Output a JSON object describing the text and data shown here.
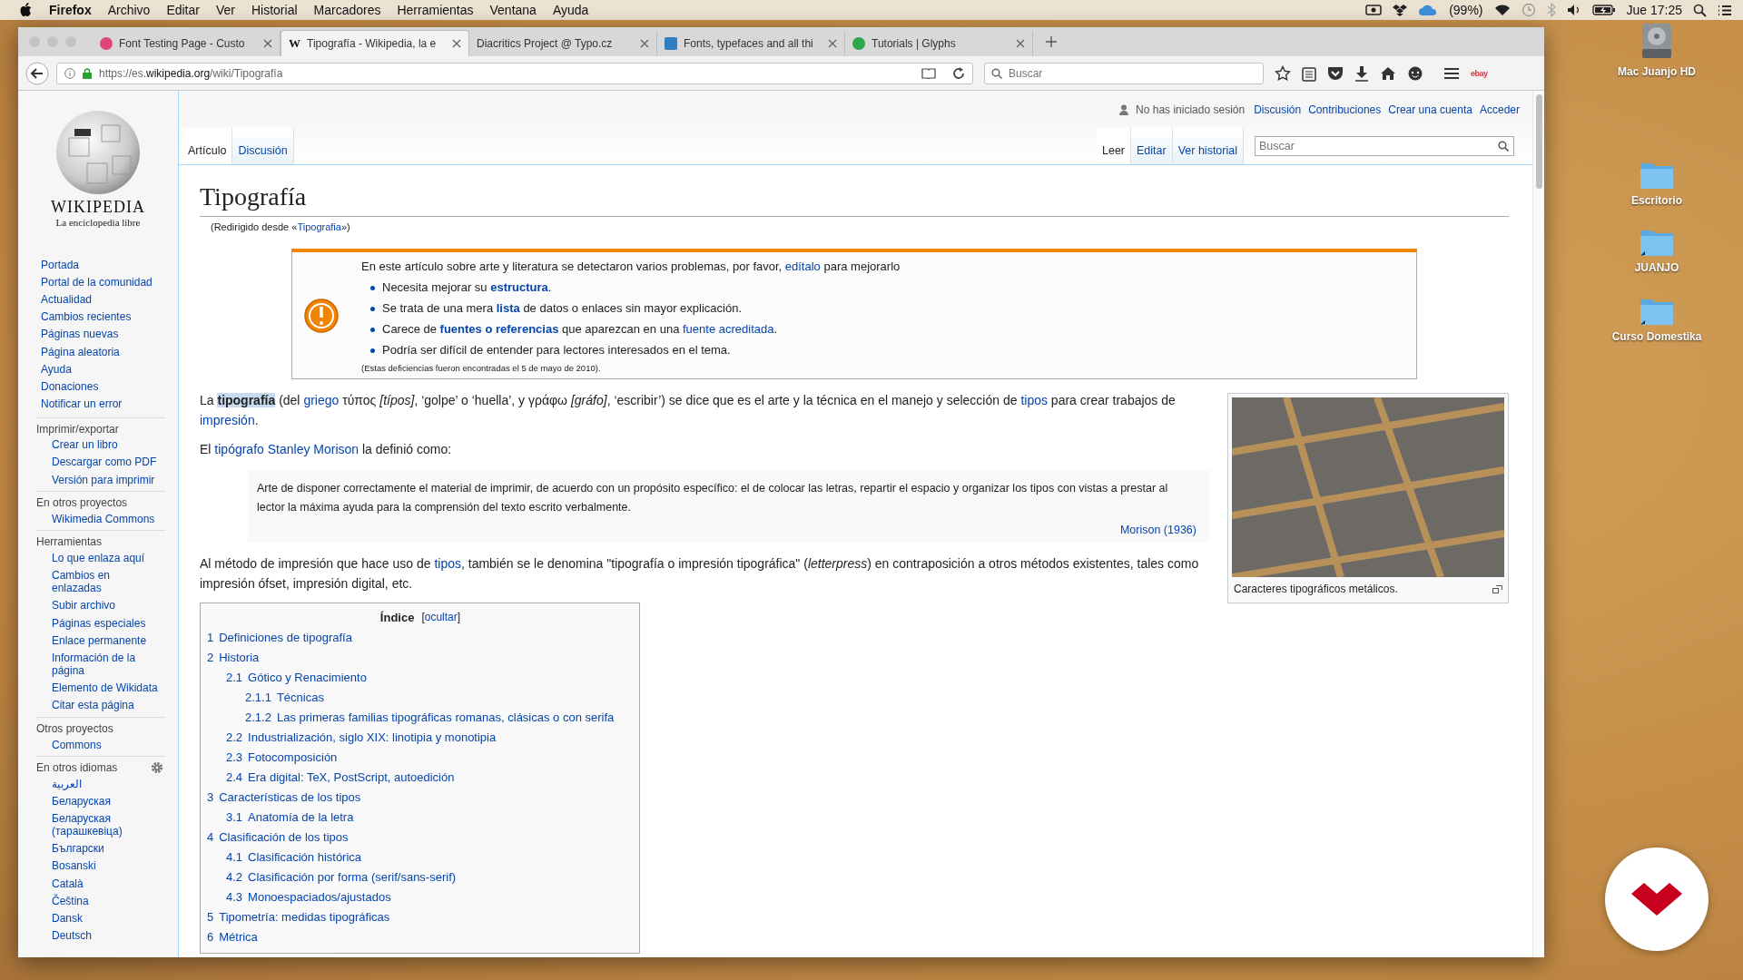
{
  "menubar": {
    "app": "Firefox",
    "menus": [
      "Archivo",
      "Editar",
      "Ver",
      "Historial",
      "Marcadores",
      "Herramientas",
      "Ventana",
      "Ayuda"
    ],
    "battery_status": "(99%)",
    "clock": "Jue 17:25"
  },
  "browser": {
    "tabs": [
      {
        "title": "Font Testing Page - Custo",
        "selected": false,
        "favicon": {
          "kind": "circle",
          "color": "#e0457b"
        }
      },
      {
        "title": "Tipografía - Wikipedia, la e",
        "selected": true,
        "favicon": {
          "kind": "letter",
          "text": "W"
        }
      },
      {
        "title": "Diacritics Project @ Typo.cz",
        "selected": false,
        "favicon": {
          "kind": "none"
        }
      },
      {
        "title": "Fonts, typefaces and all thi",
        "selected": false,
        "favicon": {
          "kind": "square",
          "color": "#2f7fc1"
        }
      },
      {
        "title": "Tutorials | Glyphs",
        "selected": false,
        "favicon": {
          "kind": "circle",
          "color": "#2aa84a"
        }
      }
    ],
    "url": {
      "prefix": "https://es.",
      "host": "wikipedia.org",
      "path": "/wiki/Tipografía"
    },
    "search": {
      "placeholder": "Buscar"
    },
    "extension_label": "ebay"
  },
  "wiki": {
    "logo": {
      "wordmark": "WIKIPEDIA",
      "tagline": "La enciclopedia libre"
    },
    "nav": {
      "main": [
        "Portada",
        "Portal de la comunidad",
        "Actualidad",
        "Cambios recientes",
        "Páginas nuevas",
        "Página aleatoria",
        "Ayuda",
        "Donaciones",
        "Notificar un error"
      ],
      "sections": [
        {
          "heading": "Imprimir/exportar",
          "has_settings": false,
          "items": [
            "Crear un libro",
            "Descargar como PDF",
            "Versión para imprimir"
          ]
        },
        {
          "heading": "En otros proyectos",
          "has_settings": false,
          "items": [
            "Wikimedia Commons"
          ]
        },
        {
          "heading": "Herramientas",
          "has_settings": false,
          "items": [
            "Lo que enlaza aquí",
            "Cambios en enlazadas",
            "Subir archivo",
            "Páginas especiales",
            "Enlace permanente",
            "Información de la página",
            "Elemento de Wikidata",
            "Citar esta página"
          ]
        },
        {
          "heading": "Otros proyectos",
          "has_settings": false,
          "items": [
            "Commons"
          ]
        },
        {
          "heading": "En otros idiomas",
          "has_settings": true,
          "items": [
            "العربية",
            "Беларуская",
            "Беларуская (тарашкевіца)",
            "Български",
            "Bosanski",
            "Català",
            "Čeština",
            "Dansk",
            "Deutsch"
          ]
        }
      ]
    },
    "personal": {
      "status": "No has iniciado sesión",
      "links": [
        "Discusión",
        "Contribuciones",
        "Crear una cuenta",
        "Acceder"
      ]
    },
    "namespace_tabs": [
      {
        "label": "Artículo",
        "selected": true
      },
      {
        "label": "Discusión",
        "selected": false
      }
    ],
    "view_tabs": [
      {
        "label": "Leer",
        "selected": true
      },
      {
        "label": "Editar",
        "selected": false
      },
      {
        "label": "Ver historial",
        "selected": false
      }
    ],
    "search": {
      "placeholder": "Buscar"
    },
    "article": {
      "title": "Tipografía",
      "redirect": [
        {
          "t": "(Redirigido desde «",
          "kind": "text"
        },
        {
          "t": "Tipografia",
          "kind": "link"
        },
        {
          "t": "»)",
          "kind": "text"
        }
      ],
      "notice": {
        "intro": [
          {
            "t": "En este artículo sobre arte y literatura se detectaron varios problemas, por favor, ",
            "kind": "text"
          },
          {
            "t": "edítalo",
            "kind": "link"
          },
          {
            "t": " para mejorarlo",
            "kind": "text"
          }
        ],
        "bullets": [
          [
            {
              "t": "Necesita mejorar su ",
              "kind": "text"
            },
            {
              "t": "estructura",
              "kind": "strong-link"
            },
            {
              "t": ".",
              "kind": "text"
            }
          ],
          [
            {
              "t": "Se trata de una mera ",
              "kind": "text"
            },
            {
              "t": "lista",
              "kind": "strong-link"
            },
            {
              "t": " de datos o enlaces sin mayor explicación.",
              "kind": "text"
            }
          ],
          [
            {
              "t": "Carece de ",
              "kind": "text"
            },
            {
              "t": "fuentes o referencias",
              "kind": "strong-link"
            },
            {
              "t": " que aparezcan en una ",
              "kind": "text"
            },
            {
              "t": "fuente acreditada",
              "kind": "link"
            },
            {
              "t": ".",
              "kind": "text"
            }
          ],
          [
            {
              "t": "Podría ser difícil de entender para lectores interesados en el tema.",
              "kind": "text"
            }
          ]
        ],
        "footnote": "(Estas deficiencias fueron encontradas el 5 de mayo de 2010)."
      },
      "figure": {
        "caption": "Caracteres tipográficos metálicos."
      },
      "paragraphs_before": [
        [
          {
            "t": "La ",
            "kind": "text"
          },
          {
            "t": "tipografía",
            "kind": "highlight"
          },
          {
            "t": " (del ",
            "kind": "text"
          },
          {
            "t": "griego",
            "kind": "link"
          },
          {
            "t": " τύπος ",
            "kind": "text"
          },
          {
            "t": "[típos]",
            "kind": "italic"
          },
          {
            "t": ", ‘golpe’ o ‘huella’, y γράφω ",
            "kind": "text"
          },
          {
            "t": "[gráfo]",
            "kind": "italic"
          },
          {
            "t": ", ‘escribir’) se dice que es el arte y la técnica en el manejo y selección de ",
            "kind": "text"
          },
          {
            "t": "tipos",
            "kind": "link"
          },
          {
            "t": " para crear trabajos de ",
            "kind": "text"
          },
          {
            "t": "impresión",
            "kind": "link"
          },
          {
            "t": ".",
            "kind": "text"
          }
        ],
        [
          {
            "t": "El ",
            "kind": "text"
          },
          {
            "t": "tipógrafo Stanley Morison",
            "kind": "link"
          },
          {
            "t": " la definió como:",
            "kind": "text"
          }
        ]
      ],
      "quote": {
        "text": "Arte de disponer correctamente el material de imprimir, de acuerdo con un propósito específico: el de colocar las letras, repartir el espacio y organizar los tipos con vistas a prestar al lector la máxima ayuda para la comprensión del texto escrito verbalmente.",
        "cite": "Morison (1936)"
      },
      "paragraphs_after": [
        [
          {
            "t": "Al método de impresión que hace uso de ",
            "kind": "text"
          },
          {
            "t": "tipos",
            "kind": "link"
          },
          {
            "t": ", también se le denomina \"tipografía o impresión tipográfica\" (",
            "kind": "text"
          },
          {
            "t": "letterpress",
            "kind": "italic"
          },
          {
            "t": ") en contraposición a otros métodos existentes, tales como impresión ófset, impresión digital, etc.",
            "kind": "text"
          }
        ]
      ],
      "toc": {
        "title": "Índice",
        "toggle": [
          {
            "t": "[",
            "kind": "text"
          },
          {
            "t": "ocultar",
            "kind": "link"
          },
          {
            "t": "]",
            "kind": "text"
          }
        ],
        "items": [
          {
            "number": "1",
            "title": "Definiciones de tipografía"
          },
          {
            "number": "2",
            "title": "Historia",
            "children": [
              {
                "number": "2.1",
                "title": "Gótico y Renacimiento",
                "children": [
                  {
                    "number": "2.1.1",
                    "title": "Técnicas"
                  },
                  {
                    "number": "2.1.2",
                    "title": "Las primeras familias tipográficas romanas, clásicas o con serifa"
                  }
                ]
              },
              {
                "number": "2.2",
                "title": "Industrialización, siglo XIX: linotipia y monotipia"
              },
              {
                "number": "2.3",
                "title": "Fotocomposición"
              },
              {
                "number": "2.4",
                "title": "Era digital: TeX, PostScript, autoedición"
              }
            ]
          },
          {
            "number": "3",
            "title": "Características de los tipos",
            "children": [
              {
                "number": "3.1",
                "title": "Anatomía de la letra"
              }
            ]
          },
          {
            "number": "4",
            "title": "Clasificación de los tipos",
            "children": [
              {
                "number": "4.1",
                "title": "Clasificación histórica"
              },
              {
                "number": "4.2",
                "title": "Clasificación por forma (serif/sans-serif)"
              },
              {
                "number": "4.3",
                "title": "Monoespaciados/ajustados"
              }
            ]
          },
          {
            "number": "5",
            "title": "Tipometría: medidas tipográficas"
          },
          {
            "number": "6",
            "title": "Métrica"
          }
        ]
      }
    }
  },
  "desktop": {
    "icons": [
      {
        "label": "Mac Juanjo HD",
        "kind": "drive"
      },
      {
        "label": "Escritorio",
        "kind": "folder"
      },
      {
        "label": "JUANJO",
        "kind": "alias-folder"
      },
      {
        "label": "Curso Domestika",
        "kind": "alias-folder"
      }
    ]
  }
}
